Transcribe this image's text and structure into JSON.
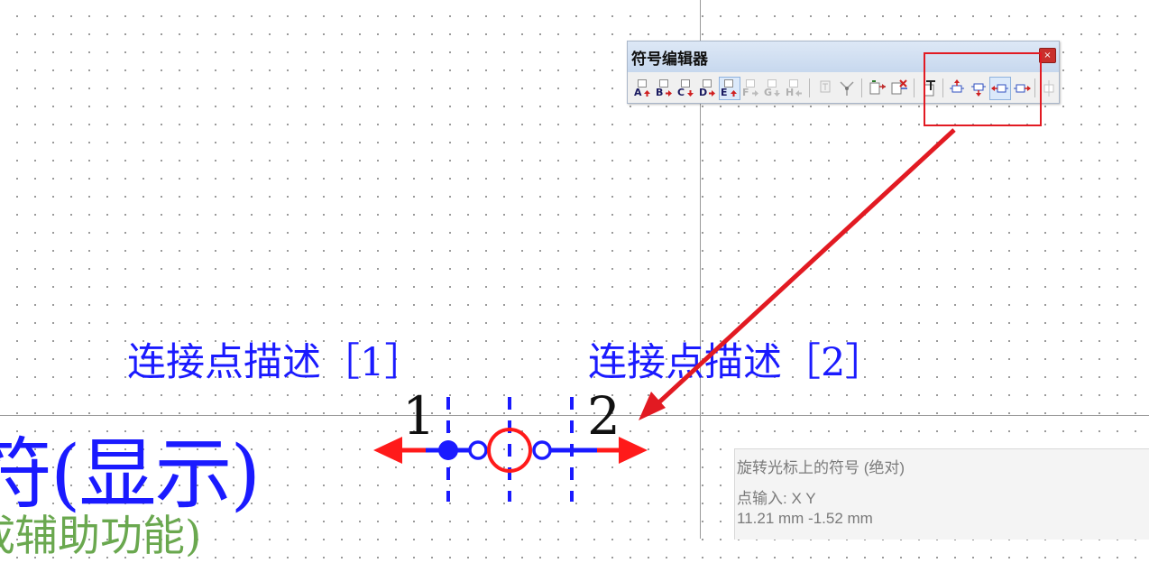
{
  "toolbar": {
    "title": "符号编辑器",
    "close_label": "×",
    "buttons_group1": [
      "A",
      "B",
      "C",
      "D",
      "E",
      "F",
      "G",
      "H"
    ]
  },
  "labels": {
    "connection_1": "连接点描述［1］",
    "connection_2": "连接点描述［2］",
    "pin_1": "1",
    "pin_2": "2"
  },
  "background_text": {
    "symbol_display": "符(显示)",
    "assist_function": "成辅助功能)"
  },
  "status": {
    "line1": "旋转光标上的符号 (绝对)",
    "line2": "点输入: X Y",
    "line3": "11.21 mm  -1.52 mm"
  },
  "colors": {
    "symbol_blue": "#1a1aff",
    "arrow_red": "#ff1a1a",
    "highlight_red": "#e21a22",
    "assist_green": "#6aa84f"
  }
}
